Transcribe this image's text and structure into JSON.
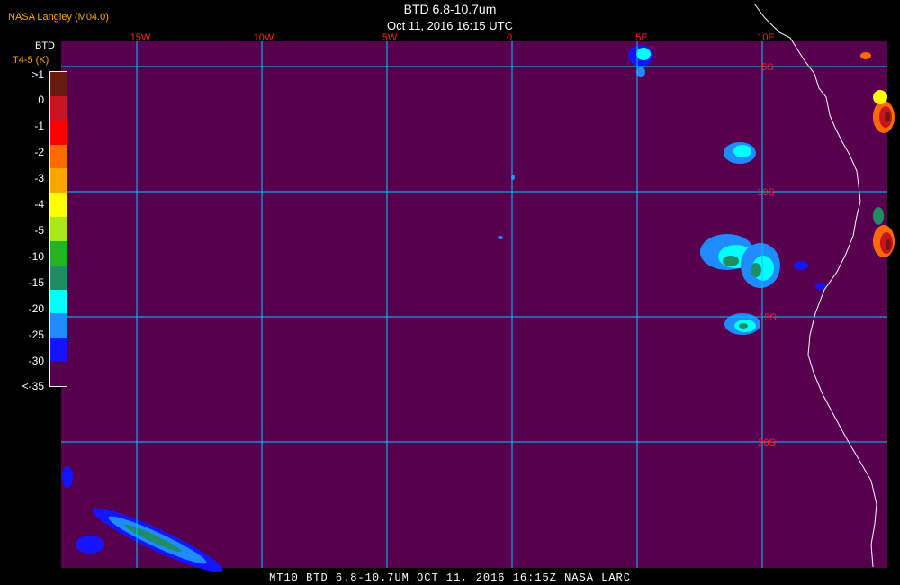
{
  "header": {
    "credit": "NASA Langley (M04.0)",
    "title": "BTD 6.8-10.7um",
    "subtitle": "Oct 11, 2016 16:15 UTC"
  },
  "legend": {
    "title": "BTD",
    "units": "T4-5 (K)",
    "labels": [
      ">1",
      "0",
      "-1",
      "-2",
      "-3",
      "-4",
      "-5",
      "-10",
      "-15",
      "-20",
      "-25",
      "-30",
      "<-35"
    ],
    "colors": [
      "#6b1a10",
      "#c8141e",
      "#ff0000",
      "#ff6a00",
      "#ffa500",
      "#ffff00",
      "#a8e61e",
      "#22b422",
      "#1e8c64",
      "#00ffff",
      "#1e8cff",
      "#1414ff",
      "#57004f"
    ]
  },
  "map": {
    "background_color": "#57004f",
    "grid_color": "#00c8ff",
    "lon_labels": [
      "15W",
      "10W",
      "5W",
      "0",
      "5E",
      "10E"
    ],
    "lat_labels": [
      "5S",
      "10S",
      "15S",
      "20S"
    ],
    "lat_label_color": "#ff2020",
    "lon_label_color": "#ff2020",
    "coastline_color": "#ffffff"
  },
  "footer": {
    "text": "MT10  BTD 6.8-10.7UM   OCT 11, 2016 16:15Z   NASA LARC"
  }
}
